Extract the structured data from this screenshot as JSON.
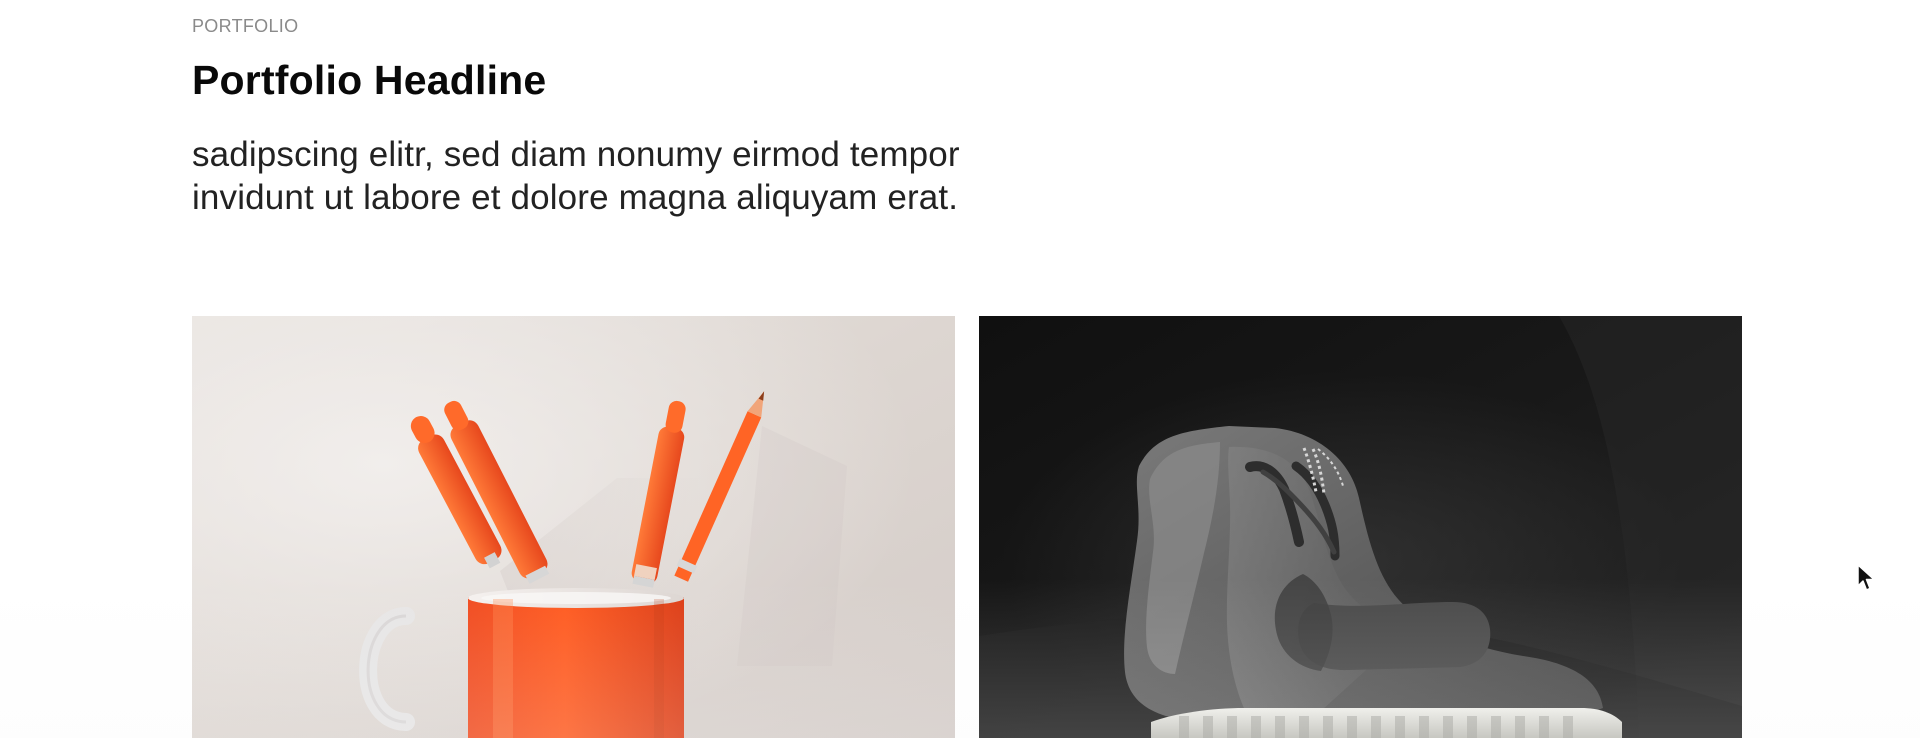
{
  "section": {
    "eyebrow": "PORTFOLIO",
    "headline": "Portfolio Headline",
    "intro_lines": [
      "sadipscing elitr, sed diam nonumy eirmod tempor",
      "invidunt ut labore et dolore magna aliquyam erat."
    ]
  },
  "portfolio": {
    "items": [
      {
        "image_subject": "orange mug with orange pens and pencil",
        "accent_color": "#ff5a1f"
      },
      {
        "image_subject": "gray high-top sneaker on dark background",
        "accent_color": "#5f5f5f"
      }
    ]
  },
  "cursor": {
    "icon": "pointer-arrow-icon"
  },
  "colors": {
    "background": "#ffffff",
    "text_primary": "#090909",
    "text_secondary": "#8a8a8a"
  }
}
